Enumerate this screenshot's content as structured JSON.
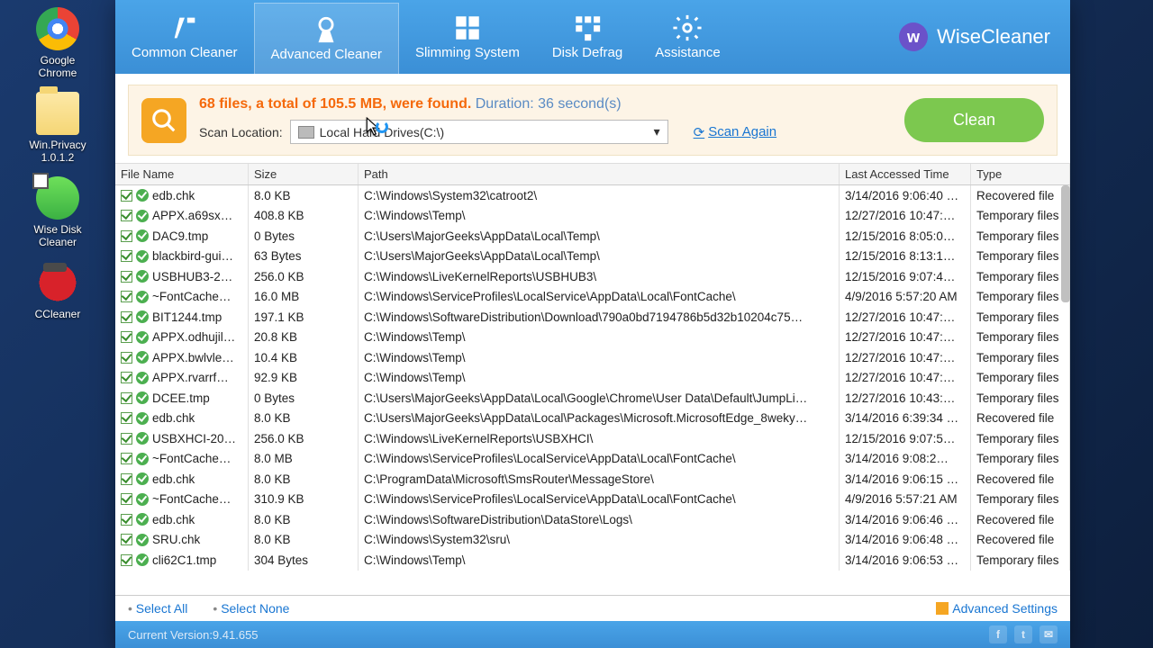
{
  "desktop": [
    {
      "label": "Google Chrome",
      "cls": "chrome"
    },
    {
      "label": "Win.Privacy 1.0.1.2",
      "cls": "folder"
    },
    {
      "label": "Wise Disk Cleaner",
      "cls": "wdc"
    },
    {
      "label": "CCleaner",
      "cls": "cc"
    }
  ],
  "brand": "WiseCleaner",
  "tabs": [
    "Common Cleaner",
    "Advanced Cleaner",
    "Slimming System",
    "Disk Defrag",
    "Assistance"
  ],
  "activeTab": 1,
  "summary": {
    "found": "68 files, a total of 105.5 MB, were found.",
    "duration": "Duration: 36 second(s)",
    "locLabel": "Scan Location:",
    "locValue": "Local Hard Drives(C:\\)",
    "scanAgain": "Scan Again",
    "clean": "Clean"
  },
  "headers": {
    "name": "File Name",
    "size": "Size",
    "path": "Path",
    "time": "Last Accessed Time",
    "type": "Type"
  },
  "rows": [
    {
      "name": "edb.chk",
      "size": "8.0 KB",
      "path": "C:\\Windows\\System32\\catroot2\\",
      "time": "3/14/2016 9:06:40 …",
      "type": "Recovered file"
    },
    {
      "name": "APPX.a69sx…",
      "size": "408.8 KB",
      "path": "C:\\Windows\\Temp\\",
      "time": "12/27/2016 10:47:…",
      "type": "Temporary files"
    },
    {
      "name": "DAC9.tmp",
      "size": "0 Bytes",
      "path": "C:\\Users\\MajorGeeks\\AppData\\Local\\Temp\\",
      "time": "12/15/2016 8:05:0…",
      "type": "Temporary files"
    },
    {
      "name": "blackbird-gui…",
      "size": "63 Bytes",
      "path": "C:\\Users\\MajorGeeks\\AppData\\Local\\Temp\\",
      "time": "12/15/2016 8:13:1…",
      "type": "Temporary files"
    },
    {
      "name": "USBHUB3-2…",
      "size": "256.0 KB",
      "path": "C:\\Windows\\LiveKernelReports\\USBHUB3\\",
      "time": "12/15/2016 9:07:4…",
      "type": "Temporary files"
    },
    {
      "name": "~FontCache…",
      "size": "16.0 MB",
      "path": "C:\\Windows\\ServiceProfiles\\LocalService\\AppData\\Local\\FontCache\\",
      "time": "4/9/2016 5:57:20 AM",
      "type": "Temporary files"
    },
    {
      "name": "BIT1244.tmp",
      "size": "197.1 KB",
      "path": "C:\\Windows\\SoftwareDistribution\\Download\\790a0bd7194786b5d32b10204c75…",
      "time": "12/27/2016 10:47:…",
      "type": "Temporary files"
    },
    {
      "name": "APPX.odhujil…",
      "size": "20.8 KB",
      "path": "C:\\Windows\\Temp\\",
      "time": "12/27/2016 10:47:…",
      "type": "Temporary files"
    },
    {
      "name": "APPX.bwlvle…",
      "size": "10.4 KB",
      "path": "C:\\Windows\\Temp\\",
      "time": "12/27/2016 10:47:…",
      "type": "Temporary files"
    },
    {
      "name": "APPX.rvarrf…",
      "size": "92.9 KB",
      "path": "C:\\Windows\\Temp\\",
      "time": "12/27/2016 10:47:…",
      "type": "Temporary files"
    },
    {
      "name": "DCEE.tmp",
      "size": "0 Bytes",
      "path": "C:\\Users\\MajorGeeks\\AppData\\Local\\Google\\Chrome\\User Data\\Default\\JumpLi…",
      "time": "12/27/2016 10:43:…",
      "type": "Temporary files"
    },
    {
      "name": "edb.chk",
      "size": "8.0 KB",
      "path": "C:\\Users\\MajorGeeks\\AppData\\Local\\Packages\\Microsoft.MicrosoftEdge_8weky…",
      "time": "3/14/2016 6:39:34 …",
      "type": "Recovered file"
    },
    {
      "name": "USBXHCI-20…",
      "size": "256.0 KB",
      "path": "C:\\Windows\\LiveKernelReports\\USBXHCI\\",
      "time": "12/15/2016 9:07:5…",
      "type": "Temporary files"
    },
    {
      "name": "~FontCache…",
      "size": "8.0 MB",
      "path": "C:\\Windows\\ServiceProfiles\\LocalService\\AppData\\Local\\FontCache\\",
      "time": "3/14/2016 9:08:2…",
      "type": "Temporary files"
    },
    {
      "name": "edb.chk",
      "size": "8.0 KB",
      "path": "C:\\ProgramData\\Microsoft\\SmsRouter\\MessageStore\\",
      "time": "3/14/2016 9:06:15 …",
      "type": "Recovered file"
    },
    {
      "name": "~FontCache…",
      "size": "310.9 KB",
      "path": "C:\\Windows\\ServiceProfiles\\LocalService\\AppData\\Local\\FontCache\\",
      "time": "4/9/2016 5:57:21 AM",
      "type": "Temporary files"
    },
    {
      "name": "edb.chk",
      "size": "8.0 KB",
      "path": "C:\\Windows\\SoftwareDistribution\\DataStore\\Logs\\",
      "time": "3/14/2016 9:06:46 …",
      "type": "Recovered file"
    },
    {
      "name": "SRU.chk",
      "size": "8.0 KB",
      "path": "C:\\Windows\\System32\\sru\\",
      "time": "3/14/2016 9:06:48 …",
      "type": "Recovered file"
    },
    {
      "name": "cli62C1.tmp",
      "size": "304 Bytes",
      "path": "C:\\Windows\\Temp\\",
      "time": "3/14/2016 9:06:53 …",
      "type": "Temporary files"
    }
  ],
  "footer": {
    "selectAll": "Select All",
    "selectNone": "Select None",
    "advanced": "Advanced Settings"
  },
  "status": "Current Version:9.41.655"
}
